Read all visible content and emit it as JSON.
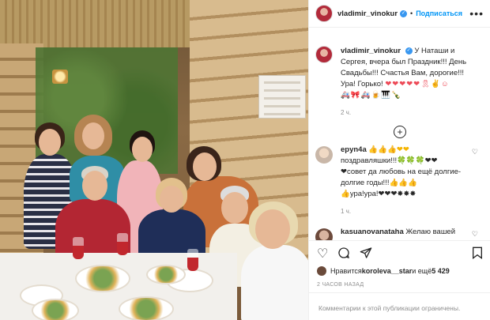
{
  "header": {
    "username": "vladimir_vinokur",
    "follow_label": "Подписаться",
    "more_label": "•••"
  },
  "caption": {
    "username": "vladimir_vinokur",
    "text": "У Наташи и Сергея, вчера был Праздник!!! День Свадьбы!!! Счастья Вам, дорогие!!! Ура! Горько!",
    "emoji_line_1": "❤❤❤❤❤🎗✌☺",
    "emoji_line_2": "🚑🎀🚑🍺🎹🍾",
    "time": "2 ч."
  },
  "load_more": "+",
  "comments": [
    {
      "username": "epyn4a",
      "text_line_1": "👍👍👍❤❤",
      "text_line_2": "поздравляшки!!!🍀🍀🍀❤❤",
      "text_line_3": "❤совет да любовь на ещё долгие-долгие годы!!!👍👍👍",
      "text_line_4": "👍ура!ура!❤❤❤✸✸✸",
      "time": "1 ч."
    },
    {
      "username": "kasuanovanataha",
      "text": "Желаю вашей"
    }
  ],
  "actions": {
    "like_icon": "heart-outline",
    "comment_icon": "speech-bubble",
    "share_icon": "paper-plane",
    "save_icon": "bookmark"
  },
  "likes": {
    "prefix": "Нравится ",
    "user": "koroleva__star",
    "and": " и ещё ",
    "count": "5 429"
  },
  "post_time": "2 ЧАСОВ НАЗАД",
  "comments_disabled": "Комментарии к этой публикации ограничены.",
  "colors": {
    "accent": "#0095f6",
    "verified": "#3897f0",
    "muted": "#8e8e8e"
  }
}
